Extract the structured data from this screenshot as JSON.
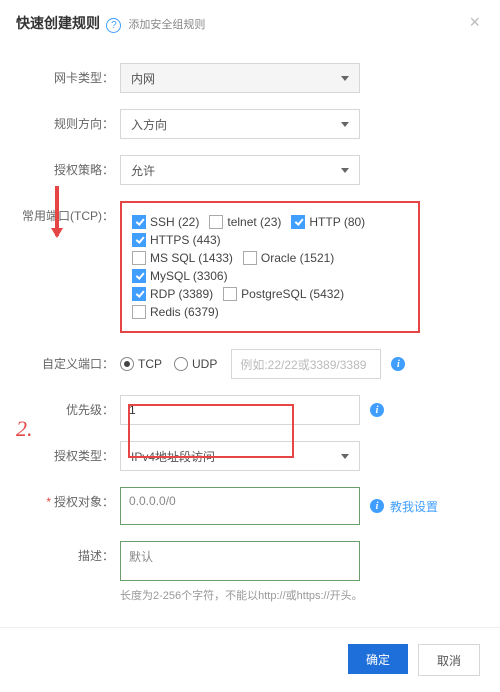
{
  "header": {
    "title": "快速创建规则",
    "subtitle": "添加安全组规则"
  },
  "labels": {
    "nic_type": "网卡类型：",
    "direction": "规则方向：",
    "policy": "授权策略：",
    "common_ports": "常用端口(TCP)：",
    "custom_port": "自定义端口：",
    "priority": "优先级：",
    "auth_type": "授权类型：",
    "auth_object": "授权对象：",
    "description": "描述："
  },
  "values": {
    "nic_type": "内网",
    "direction": "入方向",
    "policy": "允许",
    "priority": "1",
    "auth_type": "IPv4地址段访问",
    "auth_object": "0.0.0.0/0",
    "description": "默认",
    "custom_port_placeholder": "例如:22/22或3389/3389"
  },
  "protocol": {
    "tcp": "TCP",
    "udp": "UDP",
    "selected": "tcp"
  },
  "ports": [
    {
      "label": "SSH (22)",
      "checked": true
    },
    {
      "label": "telnet (23)",
      "checked": false
    },
    {
      "label": "HTTP (80)",
      "checked": true
    },
    {
      "label": "HTTPS (443)",
      "checked": true
    },
    {
      "label": "MS SQL (1433)",
      "checked": false
    },
    {
      "label": "Oracle (1521)",
      "checked": false
    },
    {
      "label": "MySQL (3306)",
      "checked": true
    },
    {
      "label": "RDP (3389)",
      "checked": true
    },
    {
      "label": "PostgreSQL (5432)",
      "checked": false
    },
    {
      "label": "Redis (6379)",
      "checked": false
    }
  ],
  "hints": {
    "description": "长度为2-256个字符，不能以http://或https://开头。",
    "teach_me": "教我设置"
  },
  "buttons": {
    "ok": "确定",
    "cancel": "取消"
  },
  "annotations": {
    "two": "2."
  }
}
